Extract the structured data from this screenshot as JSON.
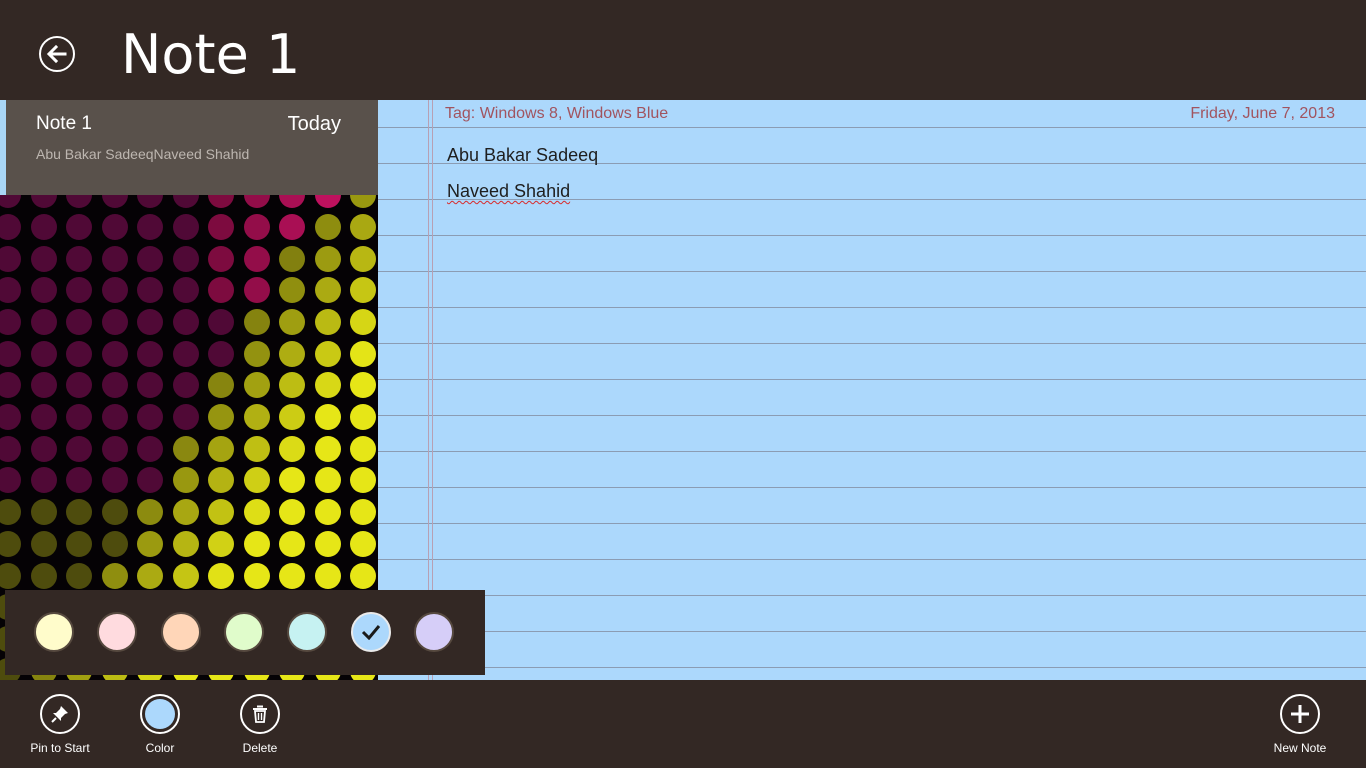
{
  "header": {
    "title": "Note 1"
  },
  "note_list": [
    {
      "title": "Note 1",
      "date": "Today",
      "snippet": "Abu Bakar SadeeqNaveed Shahid"
    }
  ],
  "note": {
    "tag": "Tag: Windows 8, Windows Blue",
    "date": "Friday, June 7, 2013",
    "lines": [
      "Abu Bakar Sadeeq",
      "Naveed Shahid"
    ]
  },
  "color_picker": {
    "swatches": [
      "#fffccb",
      "#ffdbdf",
      "#ffd6b8",
      "#e0fccb",
      "#c6f2f2",
      "#acd8fc",
      "#d6cef8"
    ],
    "selected_index": 5
  },
  "appbar": {
    "pin_label": "Pin to Start",
    "color_label": "Color",
    "delete_label": "Delete",
    "new_label": "New Note"
  },
  "colors": {
    "chrome": "#332824",
    "paper": "#acd8fc",
    "accent_text": "#a1545f"
  }
}
